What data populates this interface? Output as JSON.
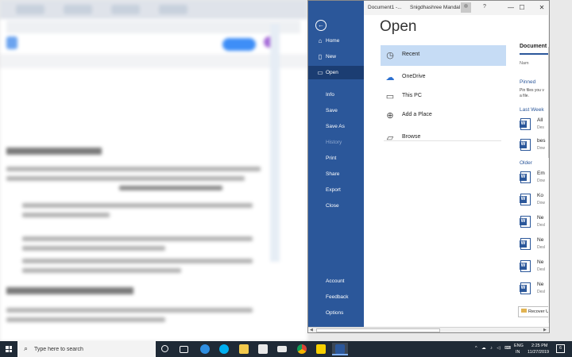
{
  "word": {
    "title": {
      "doc_name": "Document1 -...",
      "user_name": "Snigdhashree Mandal",
      "help": "?",
      "minimize": "—",
      "maximize": "☐",
      "close": "✕"
    },
    "rail": {
      "back_icon": "←",
      "items": [
        {
          "label": "Home",
          "icon": "⌂"
        },
        {
          "label": "New",
          "icon": "▯"
        },
        {
          "label": "Open",
          "icon": "▭",
          "selected": true
        },
        {
          "label": "Info"
        },
        {
          "label": "Save"
        },
        {
          "label": "Save As"
        },
        {
          "label": "History",
          "disabled": true
        },
        {
          "label": "Print"
        },
        {
          "label": "Share"
        },
        {
          "label": "Export"
        },
        {
          "label": "Close"
        }
      ],
      "bottom": [
        "Account",
        "Feedback",
        "Options"
      ]
    },
    "open": {
      "heading": "Open",
      "locations": [
        {
          "label": "Recent",
          "icon": "◷"
        },
        {
          "label": "OneDrive",
          "icon": "☁"
        },
        {
          "label": "This PC",
          "icon": "▭"
        },
        {
          "label": "Add a Place",
          "icon": "⊕"
        },
        {
          "label": "Browse",
          "icon": "▱"
        }
      ]
    },
    "recent": {
      "tab": "Document",
      "name_col": "Nam",
      "pinned_title": "Pinned",
      "pinned_text_1": "Pin files you v",
      "pinned_text_2": "a file.",
      "last_week": "Last Week",
      "older": "Older",
      "last_week_files": [
        {
          "name": "All",
          "path": "Des"
        },
        {
          "name": "bes",
          "path": "Dow"
        }
      ],
      "older_files": [
        {
          "name": "Em",
          "path": "Dow"
        },
        {
          "name": "Ko",
          "path": "Dow"
        },
        {
          "name": "Ne",
          "path": "Desl"
        },
        {
          "name": "Ne",
          "path": "Desl"
        },
        {
          "name": "Ne",
          "path": "Desl"
        },
        {
          "name": "Ne",
          "path": "Desl"
        }
      ],
      "recover": "Recover U"
    }
  },
  "taskbar": {
    "search_placeholder": "Type here to search",
    "search_icon": "⌕",
    "lang_1": "ENG",
    "lang_2": "IN",
    "time": "2:25 PM",
    "date": "11/27/2019",
    "tray_icons": "^ ☁ ♪ ◁ ⌨",
    "notification_count": "6",
    "apps": [
      {
        "name": "cortana",
        "color": "#ffffff"
      },
      {
        "name": "task-view",
        "color": "#ffffff"
      },
      {
        "name": "edge",
        "color": "#2f8ee0"
      },
      {
        "name": "skype",
        "color": "#00aff0"
      },
      {
        "name": "file-explorer",
        "color": "#f2c94c"
      },
      {
        "name": "store",
        "color": "#e8e8e8"
      },
      {
        "name": "mail",
        "color": "#e8e8e8"
      },
      {
        "name": "chrome",
        "color": "#e3a21a"
      },
      {
        "name": "sticky-notes",
        "color": "#f7d000"
      },
      {
        "name": "word",
        "color": "#2b579a"
      }
    ]
  },
  "colors": {
    "word_blue": "#2b579a",
    "selected_location": "#c6dcf5",
    "taskbar": "#1f2a36"
  }
}
